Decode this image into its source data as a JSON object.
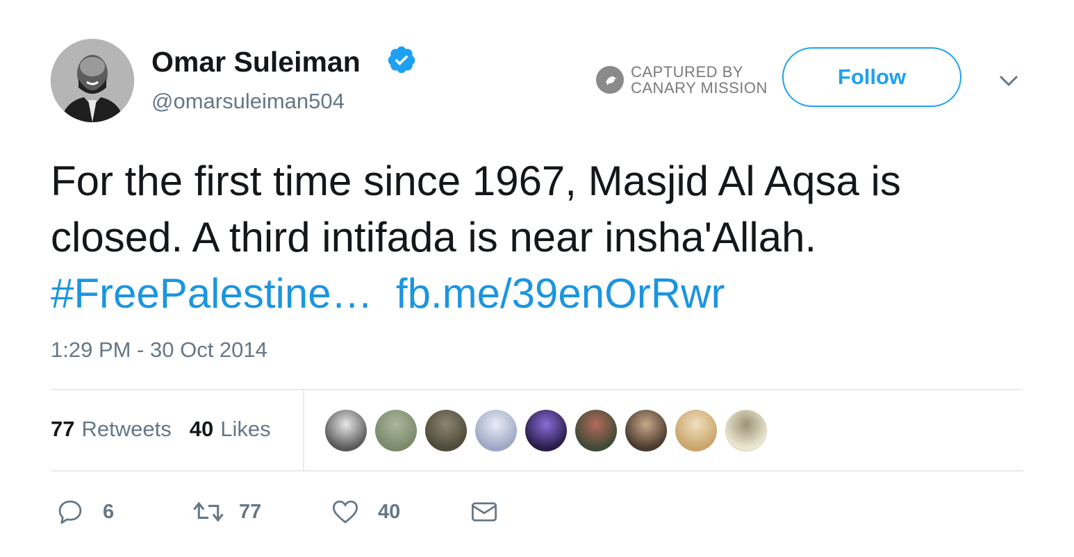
{
  "author": {
    "name": "Omar Suleiman",
    "handle": "@omarsuleiman504",
    "verified": true
  },
  "captured_badge": {
    "line1": "CAPTURED BY",
    "line2": "CANARY MISSION"
  },
  "follow_label": "Follow",
  "tweet": {
    "text_plain": "For the first time since 1967, Masjid Al Aqsa is closed. A third intifada is near insha'Allah.",
    "hashtag": "#FreePalestine…",
    "link": "fb.me/39enOrRwr",
    "timestamp": "1:29 PM - 30 Oct 2014"
  },
  "stats": {
    "retweets_count": "77",
    "retweets_label": "Retweets",
    "likes_count": "40",
    "likes_label": "Likes"
  },
  "liker_faces": [
    {
      "color": "#5a5a5a",
      "accent": "#e8e8e8"
    },
    {
      "color": "#7b8a6c",
      "accent": "#aab79a"
    },
    {
      "color": "#4f4a3a",
      "accent": "#8d8570"
    },
    {
      "color": "#9ea8c4",
      "accent": "#e8ecf7"
    },
    {
      "color": "#2b1c4a",
      "accent": "#8a6dd8"
    },
    {
      "color": "#3e4a36",
      "accent": "#b56a5a"
    },
    {
      "color": "#4a3a2e",
      "accent": "#c9a88a"
    },
    {
      "color": "#c9a56a",
      "accent": "#f0dfc0"
    },
    {
      "color": "#ece7d2",
      "accent": "#9c9276"
    }
  ],
  "actions": {
    "reply_count": "6",
    "retweet_count": "77",
    "like_count": "40"
  },
  "colors": {
    "accent": "#1da1f2",
    "link": "#1b95e0",
    "muted": "#657786",
    "text": "#14171a"
  }
}
